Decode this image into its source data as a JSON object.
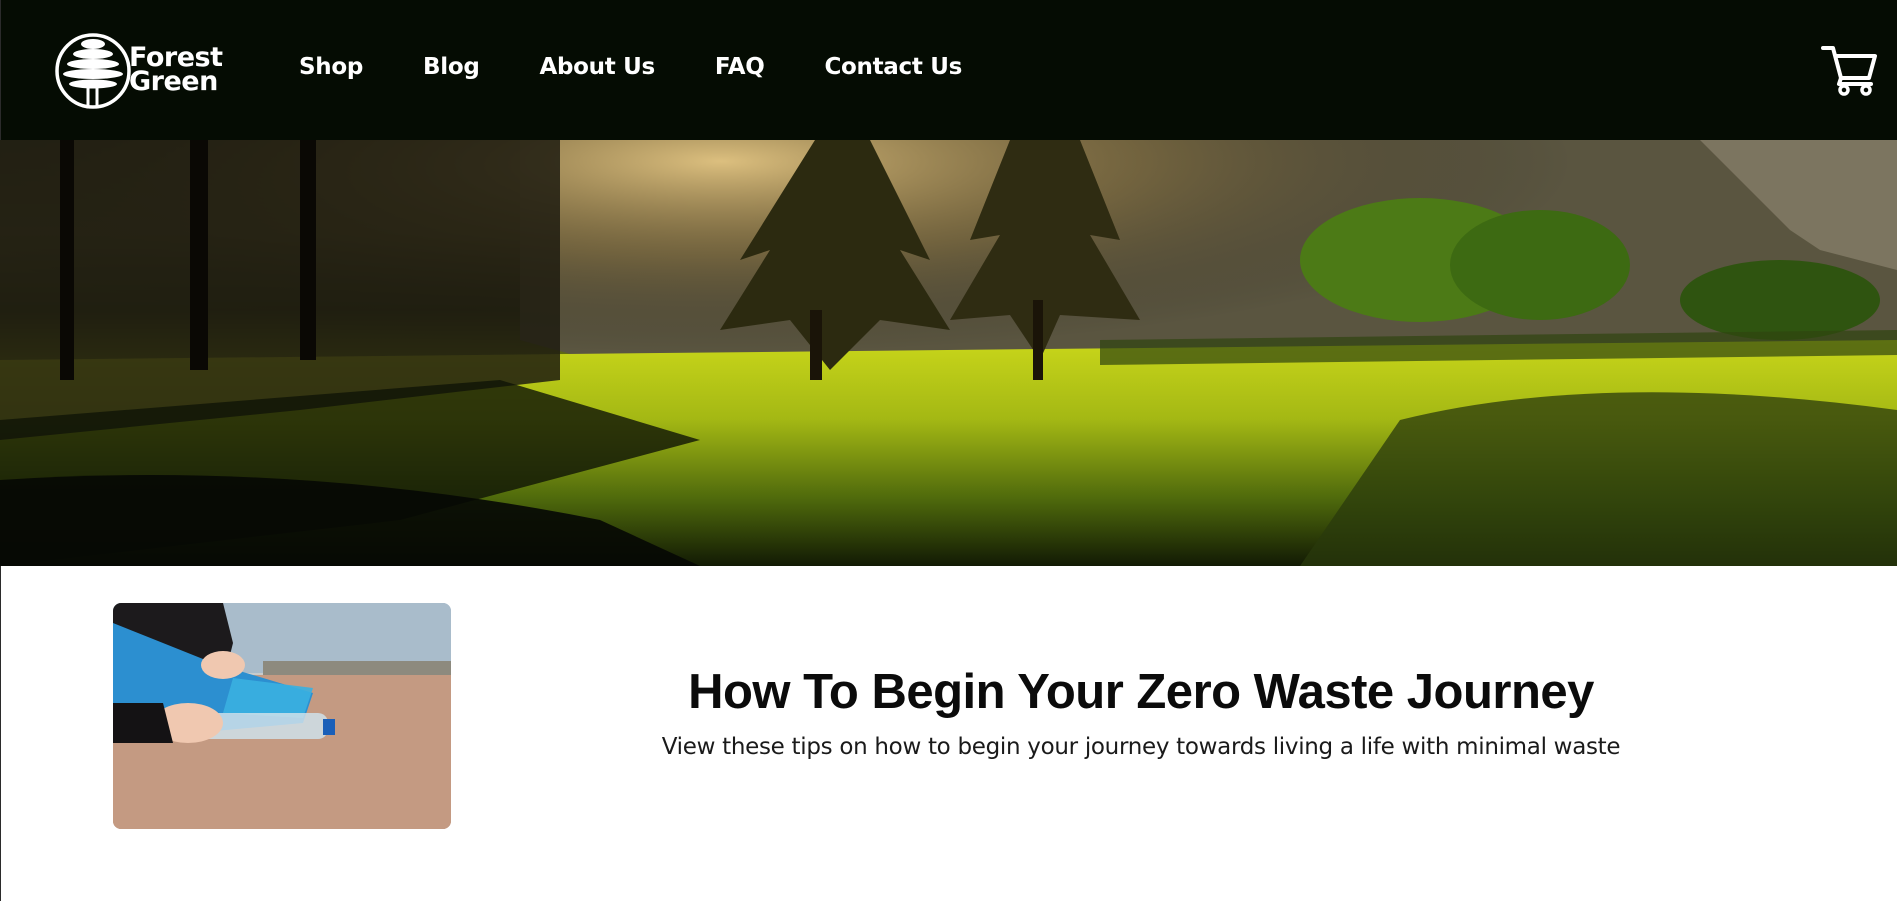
{
  "brand": {
    "line1": "Forest",
    "line2": "Green",
    "logo_icon": "tree-icon"
  },
  "nav": {
    "items": [
      {
        "label": "Shop"
      },
      {
        "label": "Blog"
      },
      {
        "label": "About Us"
      },
      {
        "label": "FAQ"
      },
      {
        "label": "Contact Us"
      }
    ],
    "cart_icon": "shopping-cart-icon"
  },
  "hero": {
    "image": "forest-meadow-sunlight"
  },
  "post": {
    "title": "How To Begin Your Zero Waste Journey",
    "subtitle": "View these tips on how to begin your journey towards living a life with minimal waste",
    "thumbnail": "hands-picking-up-plastic-bottle-on-beach"
  },
  "colors": {
    "nav_background": "#050c03",
    "text_dark": "#0b0b0b",
    "nav_text": "#ffffff"
  }
}
